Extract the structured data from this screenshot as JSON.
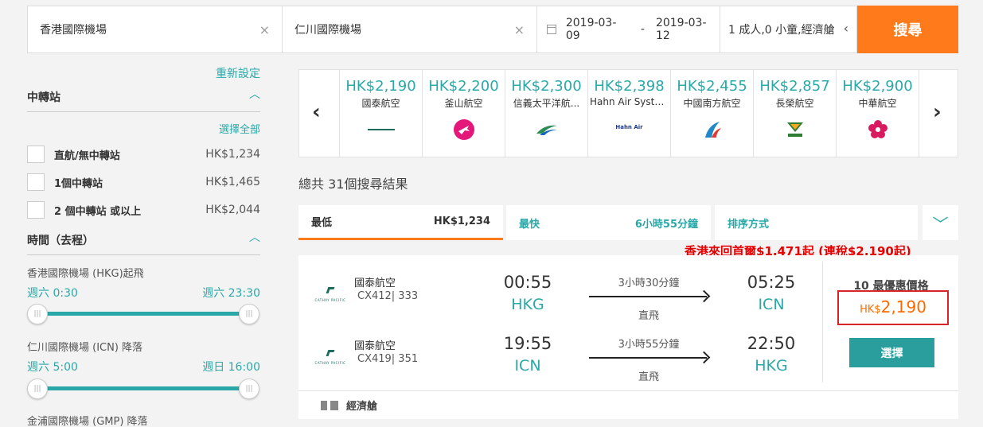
{
  "search": {
    "origin": "香港國際機場",
    "destination": "仁川國際機場",
    "depart_date": "2019-03-09",
    "date_sep": "-",
    "return_date": "2019-03-12",
    "passengers": "1 成人,0 小童,經濟艙",
    "button": "搜尋",
    "clear_glyph": "×",
    "pax_glyph": "‹"
  },
  "sidebar": {
    "reset": "重新設定",
    "stops_title": "中轉站",
    "select_all": "選擇全部",
    "stops": [
      {
        "label": "直航/無中轉站",
        "price": "HK$1,234"
      },
      {
        "label": "1個中轉站",
        "price": "HK$1,465"
      },
      {
        "label": "2 個中轉站 或以上",
        "price": "HK$2,044"
      }
    ],
    "time_title": "時間（去程）",
    "sliders": [
      {
        "title": "香港國際機場 (HKG)起飛",
        "from": "週六 0:30",
        "to": "週六 23:30"
      },
      {
        "title": "仁川國際機場 (ICN) 降落",
        "from": "週六 5:00",
        "to": "週日 16:00"
      }
    ],
    "extra_title": "金浦國際機場 (GMP) 降落"
  },
  "carousel": {
    "items": [
      {
        "price": "HK$2,190",
        "airline": "國泰航空",
        "logo": "cathay-logo",
        "color": "#1b6b5e"
      },
      {
        "price": "HK$2,200",
        "airline": "釜山航空",
        "logo": "air-busan-logo",
        "color": "#e4177b"
      },
      {
        "price": "HK$2,300",
        "airline": "信義太平洋航...",
        "logo": "cebu-logo",
        "color": "#2e8b57"
      },
      {
        "price": "HK$2,398",
        "airline": "Hahn Air Syste...",
        "logo": "hahn-air-logo",
        "color": "#1e3a8a"
      },
      {
        "price": "HK$2,455",
        "airline": "中國南方航空",
        "logo": "china-southern-logo",
        "color": "#1e88c8"
      },
      {
        "price": "HK$2,857",
        "airline": "長榮航空",
        "logo": "eva-air-logo",
        "color": "#2e7d32"
      },
      {
        "price": "HK$2,900",
        "airline": "中華航空",
        "logo": "china-airlines-logo",
        "color": "#d81b60"
      }
    ],
    "hahn_logo_text": "Hahn Air",
    "prev_glyph": "‹",
    "next_glyph": "›"
  },
  "results": {
    "total": "總共 31個搜尋結果",
    "sort": {
      "low_label": "最低",
      "low_value": "HK$1,234",
      "fast_label": "最快",
      "fast_value": "6小時55分鐘",
      "order_label": "排序方式",
      "toggle_glyph": "﹀"
    },
    "promo": "香港來回首爾$1,471起 (連稅$2,190起)",
    "card": {
      "cathay_text": "CATHAY PACIFIC",
      "legs": [
        {
          "airline": "國泰航空",
          "flight": "CX412| 333",
          "dep_time": "00:55",
          "dep_apt": "HKG",
          "duration": "3小時30分鐘",
          "type": "直飛",
          "arr_time": "05:25",
          "arr_apt": "ICN"
        },
        {
          "airline": "國泰航空",
          "flight": "CX419| 351",
          "dep_time": "19:55",
          "dep_apt": "ICN",
          "duration": "3小時55分鐘",
          "type": "直飛",
          "arr_time": "22:50",
          "arr_apt": "HKG"
        }
      ],
      "best_label": "10 最優惠價格",
      "currency": "HK$",
      "price": "2,190",
      "select": "選擇",
      "cabin": "經濟艙"
    }
  },
  "colors": {
    "accent": "#2aa8a8",
    "orange": "#ff7a1a",
    "red": "#e60000"
  }
}
